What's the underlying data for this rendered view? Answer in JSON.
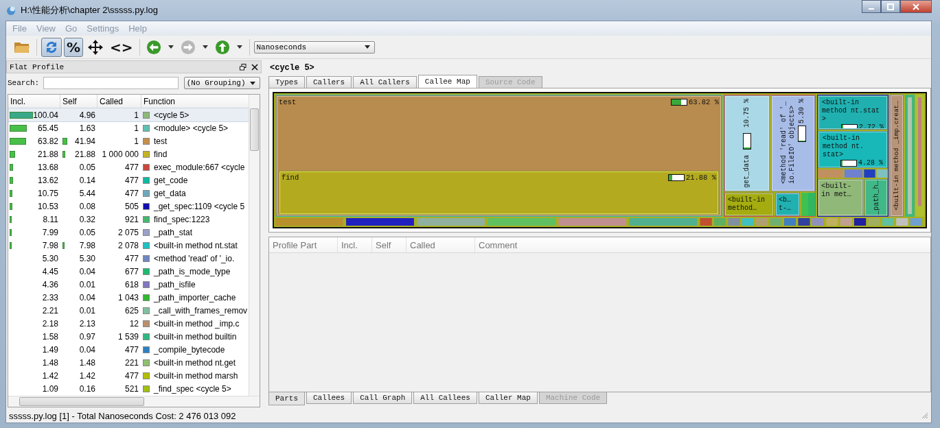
{
  "window": {
    "title": "H:\\性能分析\\chapter 2\\sssss.py.log"
  },
  "menu": [
    "File",
    "View",
    "Go",
    "Settings",
    "Help"
  ],
  "toolbar": [
    {
      "kind": "open"
    },
    {
      "kind": "cycle",
      "on": true
    },
    {
      "kind": "text",
      "label": "%",
      "on": true
    },
    {
      "kind": "move"
    },
    {
      "kind": "plain",
      "label": "<>"
    },
    {
      "kind": "back",
      "disabled": false
    },
    {
      "kind": "caret"
    },
    {
      "kind": "forward",
      "disabled": true
    },
    {
      "kind": "caret"
    },
    {
      "kind": "up",
      "disabled": false
    },
    {
      "kind": "caret"
    }
  ],
  "cost_type": "Nanoseconds",
  "flat_profile": {
    "title": "Flat Profile",
    "search_label": "Search:",
    "grouping": "(No Grouping)",
    "columns": [
      "Incl.",
      "Self",
      "Called",
      "Function"
    ],
    "rows": [
      {
        "incl": "100.04",
        "incl_bar": {
          "level": 1.0
        },
        "self": "4.96",
        "called": "1",
        "function": "<cycle 5>",
        "color": "#8fb87a",
        "selected": true
      },
      {
        "incl": "65.45",
        "incl_bar": {
          "level": 0.65
        },
        "self": "1.63",
        "called": "1",
        "function": "<module> <cycle 5>",
        "color": "#5ec1ae",
        "selected": false
      },
      {
        "incl": "63.82",
        "incl_bar": {
          "level": 0.64
        },
        "self": "41.94",
        "self_bar": {
          "level": 0.42
        },
        "called": "1",
        "function": "test",
        "color": "#c4904f",
        "selected": false
      },
      {
        "incl": "21.88",
        "incl_bar": {
          "level": 0.22
        },
        "self": "21.88",
        "self_bar": {
          "level": 0.22
        },
        "called": "1 000 000",
        "function": "find",
        "color": "#c4b421",
        "selected": false
      },
      {
        "incl": "13.68",
        "incl_bar": {
          "level": 0.14
        },
        "self": "0.05",
        "called": "477",
        "function": "exec_module:667 <cycle",
        "color": "#c9473d",
        "selected": false
      },
      {
        "incl": "13.62",
        "incl_bar": {
          "level": 0.14
        },
        "self": "0.14",
        "called": "477",
        "function": "get_code",
        "color": "#10b8a0",
        "selected": false
      },
      {
        "incl": "10.75",
        "incl_bar": {
          "level": 0.11
        },
        "self": "5.44",
        "called": "477",
        "function": "get_data",
        "color": "#6fa8bd",
        "selected": false
      },
      {
        "incl": "10.53",
        "incl_bar": {
          "level": 0.11
        },
        "self": "0.08",
        "called": "505",
        "function": "_get_spec:1109 <cycle 5",
        "color": "#1010b0",
        "selected": false
      },
      {
        "incl": "8.11",
        "incl_bar": {
          "level": 0.08
        },
        "self": "0.32",
        "called": "921",
        "function": "find_spec:1223",
        "color": "#46b86e",
        "selected": false
      },
      {
        "incl": "7.99",
        "incl_bar": {
          "level": 0.08
        },
        "self": "0.05",
        "called": "2 075",
        "function": "_path_stat",
        "color": "#9aa0c8",
        "selected": false
      },
      {
        "incl": "7.98",
        "incl_bar": {
          "level": 0.08
        },
        "self": "7.98",
        "self_bar": {
          "level": 0.08
        },
        "called": "2 078",
        "function": "<built-in method nt.stat",
        "color": "#20c0c0",
        "selected": false
      },
      {
        "incl": "5.30",
        "self": "5.30",
        "called": "477",
        "function": "<method 'read' of '_io.",
        "color": "#7088c0",
        "selected": false
      },
      {
        "incl": "4.45",
        "self": "0.04",
        "called": "677",
        "function": "_path_is_mode_type",
        "color": "#20b870",
        "selected": false
      },
      {
        "incl": "4.36",
        "self": "0.01",
        "called": "618",
        "function": "_path_isfile",
        "color": "#8078c0",
        "selected": false
      },
      {
        "incl": "2.33",
        "self": "0.04",
        "called": "1 043",
        "function": "_path_importer_cache",
        "color": "#30b830",
        "selected": false
      },
      {
        "incl": "2.21",
        "self": "0.01",
        "called": "625",
        "function": "_call_with_frames_remov",
        "color": "#80c0a0",
        "selected": false
      },
      {
        "incl": "2.18",
        "self": "2.13",
        "called": "12",
        "function": "<built-in method _imp.c",
        "color": "#b89070",
        "selected": false
      },
      {
        "incl": "1.58",
        "self": "0.97",
        "called": "1 539",
        "function": "<built-in method builtin",
        "color": "#30b880",
        "selected": false
      },
      {
        "incl": "1.49",
        "self": "0.04",
        "called": "477",
        "function": "_compile_bytecode",
        "color": "#3080c0",
        "selected": false
      },
      {
        "incl": "1.48",
        "self": "1.48",
        "called": "221",
        "function": "<built-in method nt.get",
        "color": "#90c070",
        "selected": false
      },
      {
        "incl": "1.42",
        "self": "1.42",
        "called": "477",
        "function": "<built-in method marsh",
        "color": "#b0c000",
        "selected": false
      },
      {
        "incl": "1.09",
        "self": "0.16",
        "called": "521",
        "function": "_find_spec <cycle 5>",
        "color": "#a0c010",
        "selected": false
      }
    ]
  },
  "function_title": "<cycle 5>",
  "top_tabs": [
    {
      "label": "Types",
      "selected": false,
      "disabled": false
    },
    {
      "label": "Callers",
      "selected": false,
      "disabled": false
    },
    {
      "label": "All Callers",
      "selected": false,
      "disabled": false
    },
    {
      "label": "Callee Map",
      "selected": true,
      "disabled": false
    },
    {
      "label": "Source Code",
      "selected": false,
      "disabled": true
    }
  ],
  "callee_map": {
    "test": {
      "label": "test",
      "percent": "63.82 %",
      "level": 0.64,
      "color": "#b88c4e"
    },
    "find": {
      "label": "find",
      "percent": "21.88 %",
      "level": 0.22,
      "color": "#b3aa20"
    },
    "get_data": {
      "label": "get_data",
      "percent": "10.75 %",
      "level": 0.11,
      "color": "#aad8e6"
    },
    "read": {
      "label": "<method 'read' of '_io.FileIO' objects>",
      "percent": "5.30 %",
      "level": 0.05,
      "color": "#a8bce8"
    },
    "get_data_callees": [
      {
        "label": "<built-in method…",
        "color": "#a4ac10"
      },
      {
        "label": "<b… t-…",
        "color": "#20b0b0"
      }
    ],
    "stat_blocks": [
      {
        "label": "<built-in method nt.stat >",
        "percent": "2.72 %",
        "level": 0.03,
        "color": "#20b0b0"
      },
      {
        "label": "<built-in method nt. stat>",
        "percent": "4.28 %",
        "level": 0.04,
        "color": "#18b8b8"
      }
    ],
    "path_blocks": [
      {
        "label": "<built-in met…",
        "color": "#90b878"
      },
      {
        "label": "_path_h…",
        "color": "#40b888"
      }
    ],
    "imp": {
      "label": "<built-in method _imp.creat…",
      "color": "#b89478"
    }
  },
  "parts_columns": [
    "Profile Part",
    "Incl.",
    "Self",
    "Called",
    "Comment"
  ],
  "bottom_tabs": [
    {
      "label": "Parts",
      "selected": true,
      "disabled": false
    },
    {
      "label": "Callees",
      "selected": false,
      "disabled": false
    },
    {
      "label": "Call Graph",
      "selected": false,
      "disabled": false
    },
    {
      "label": "All Callees",
      "selected": false,
      "disabled": false
    },
    {
      "label": "Caller Map",
      "selected": false,
      "disabled": false
    },
    {
      "label": "Machine Code",
      "selected": false,
      "disabled": true
    }
  ],
  "status_bar": "sssss.py.log [1] - Total Nanoseconds Cost: 2 476 013 092"
}
